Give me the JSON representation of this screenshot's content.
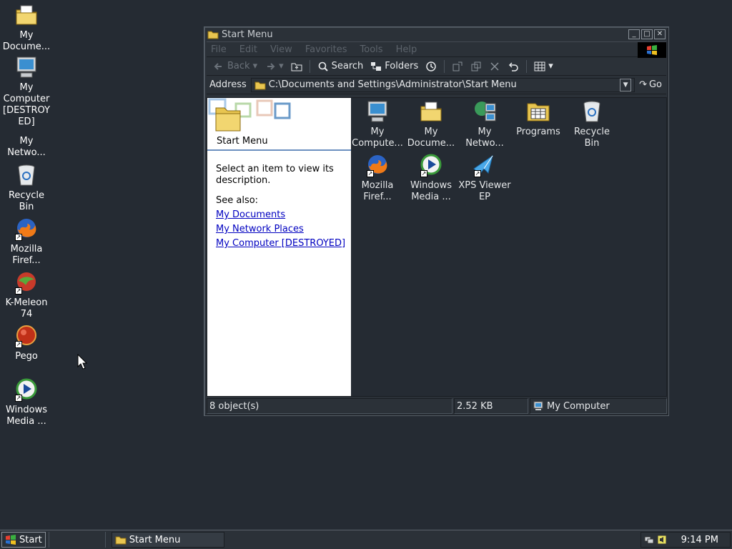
{
  "desktop": {
    "icons": [
      {
        "label": "My Docume...",
        "icon": "my-documents-icon"
      },
      {
        "label": "My Computer [DESTROY ED]",
        "icon": "my-computer-icon"
      },
      {
        "label": "My Netwo...",
        "icon": "network-places-icon"
      },
      {
        "label": "Recycle Bin",
        "icon": "recycle-bin-icon"
      },
      {
        "label": "Mozilla Firef...",
        "icon": "firefox-icon"
      },
      {
        "label": "K-Meleon 74",
        "icon": "k-meleon-icon"
      },
      {
        "label": "Pego",
        "icon": "pego-icon"
      },
      {
        "label": "Windows Media ...",
        "icon": "windows-media-icon"
      }
    ]
  },
  "window": {
    "title": "Start Menu",
    "menu": [
      "File",
      "Edit",
      "View",
      "Favorites",
      "Tools",
      "Help"
    ],
    "toolbar": {
      "back": "Back",
      "search": "Search",
      "folders": "Folders"
    },
    "address": {
      "label": "Address",
      "value": "C:\\Documents and Settings\\Administrator\\Start Menu",
      "go": "Go"
    },
    "left_pane": {
      "title": "Start Menu",
      "description": "Select an item to view its description.",
      "see_also": "See also:",
      "links": [
        "My Documents",
        "My Network Places",
        "My Computer [DESTROYED]"
      ]
    },
    "files": [
      {
        "label": "My Compute...",
        "icon": "my-computer-icon"
      },
      {
        "label": "My Docume...",
        "icon": "my-documents-icon"
      },
      {
        "label": "My Netwo...",
        "icon": "network-places-icon"
      },
      {
        "label": "Programs",
        "icon": "programs-folder-icon"
      },
      {
        "label": "Recycle Bin",
        "icon": "recycle-bin-icon"
      },
      {
        "label": "Mozilla Firef...",
        "icon": "firefox-icon"
      },
      {
        "label": "Windows Media ...",
        "icon": "windows-media-icon"
      },
      {
        "label": "XPS Viewer EP",
        "icon": "xps-viewer-icon"
      }
    ],
    "status": {
      "objects": "8 object(s)",
      "size": "2.52 KB",
      "zone": "My Computer"
    }
  },
  "taskbar": {
    "start": "Start",
    "task": "Start Menu",
    "clock": "9:14 PM"
  }
}
